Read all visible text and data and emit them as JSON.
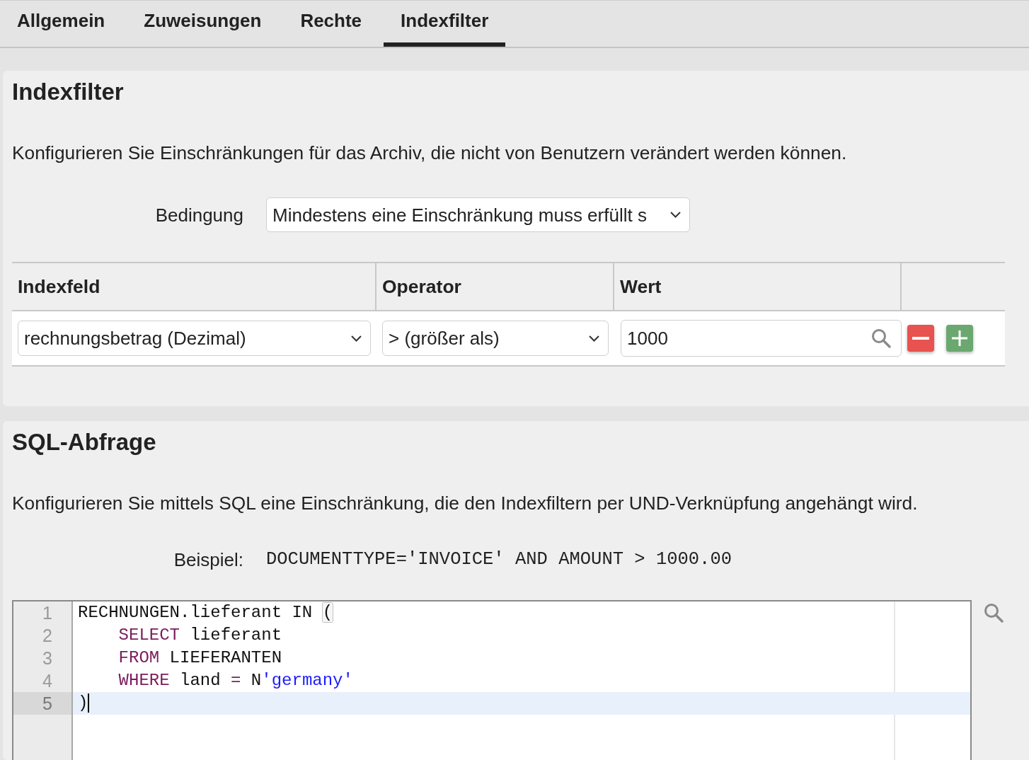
{
  "tabs": [
    {
      "label": "Allgemein",
      "selected": false
    },
    {
      "label": "Zuweisungen",
      "selected": false
    },
    {
      "label": "Rechte",
      "selected": false
    },
    {
      "label": "Indexfilter",
      "selected": true
    }
  ],
  "indexfilter": {
    "title": "Indexfilter",
    "description": "Konfigurieren Sie Einschränkungen für das Archiv, die nicht von Benutzern verändert werden können.",
    "condition": {
      "label": "Bedingung",
      "value": "Mindestens eine Einschränkung muss erfüllt s"
    },
    "table": {
      "columns": [
        "Indexfeld",
        "Operator",
        "Wert"
      ],
      "rows": [
        {
          "field": "rechnungsbetrag (Dezimal)",
          "operator": "> (größer als)",
          "value": "1000"
        }
      ]
    }
  },
  "sql": {
    "title": "SQL-Abfrage",
    "description": "Konfigurieren Sie mittels SQL eine Einschränkung, die den Indexfiltern per UND-Verknüpfung angehängt wird.",
    "example": {
      "label": "Beispiel:",
      "code": "DOCUMENTTYPE='INVOICE' AND AMOUNT > 1000.00"
    },
    "editor": {
      "lines": [
        {
          "number": "1",
          "active": false,
          "tokens": [
            {
              "kind": "plain",
              "text": "RECHNUNGEN.lieferant IN "
            },
            {
              "kind": "matched_bracket",
              "text": "("
            }
          ]
        },
        {
          "number": "2",
          "active": false,
          "tokens": [
            {
              "kind": "keyword",
              "text": "    SELECT"
            },
            {
              "kind": "plain",
              "text": " lieferant"
            }
          ]
        },
        {
          "number": "3",
          "active": false,
          "tokens": [
            {
              "kind": "keyword",
              "text": "    FROM"
            },
            {
              "kind": "plain",
              "text": " LIEFERANTEN"
            }
          ]
        },
        {
          "number": "4",
          "active": false,
          "tokens": [
            {
              "kind": "keyword",
              "text": "    WHERE"
            },
            {
              "kind": "plain",
              "text": " land "
            },
            {
              "kind": "operator",
              "text": "="
            },
            {
              "kind": "plain",
              "text": " N"
            },
            {
              "kind": "string",
              "text": "'germany'"
            }
          ]
        },
        {
          "number": "5",
          "active": true,
          "tokens": [
            {
              "kind": "plain",
              "text": ")"
            }
          ]
        }
      ]
    }
  }
}
